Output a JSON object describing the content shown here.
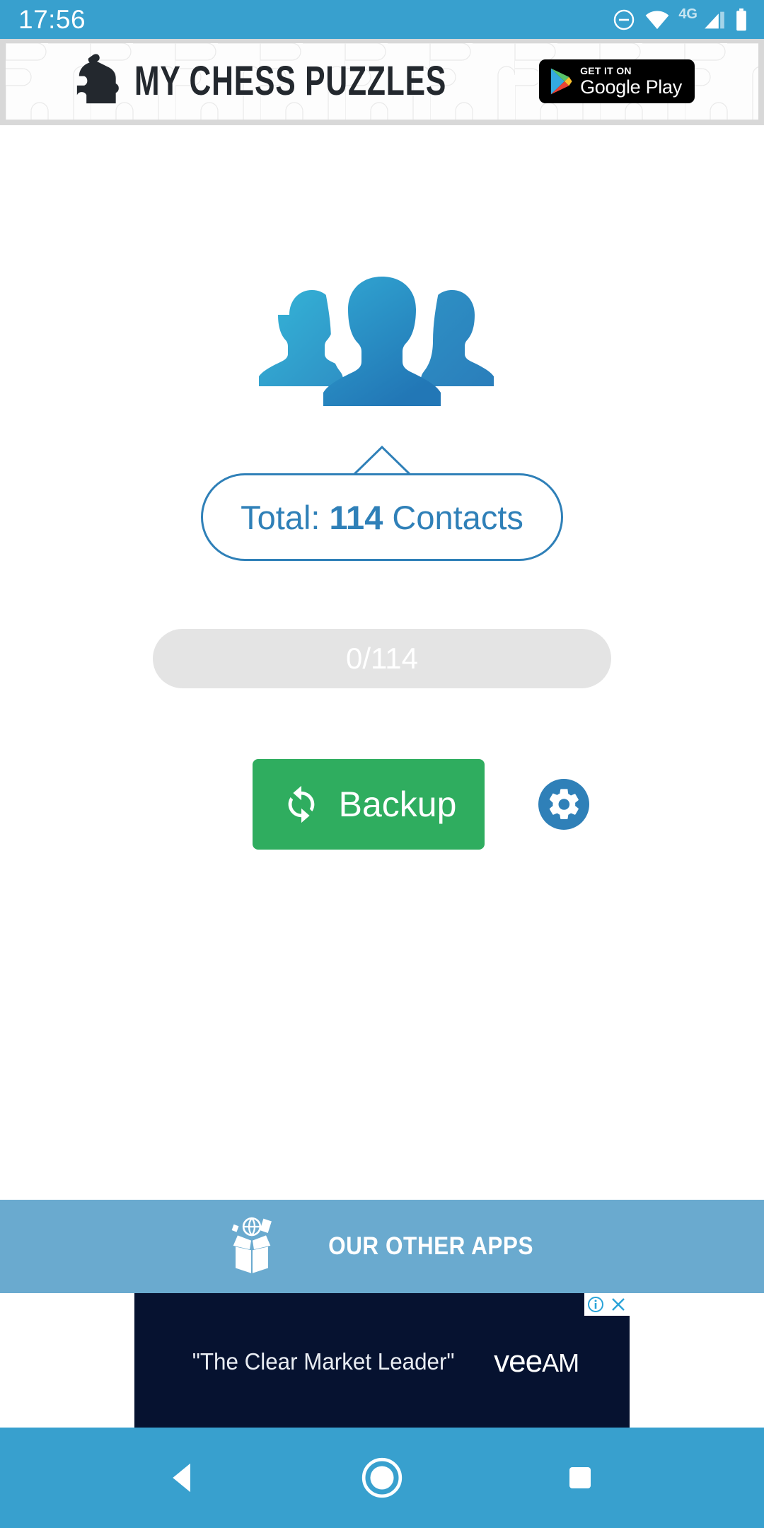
{
  "status_bar": {
    "time": "17:56",
    "background_color": "#38a0ce",
    "icons": [
      {
        "name": "do-not-disturb-icon",
        "label": "Do not disturb"
      },
      {
        "name": "wifi-icon",
        "label": "Wi-Fi"
      },
      {
        "name": "network-type-label",
        "label": "4G"
      },
      {
        "name": "cellular-signal-icon",
        "label": "Signal"
      },
      {
        "name": "battery-icon",
        "label": "Battery"
      }
    ]
  },
  "top_ad": {
    "app_name": "MY CHESS PUZZLES",
    "store_badge": {
      "small_text": "GET IT ON",
      "big_text": "Google Play"
    }
  },
  "main": {
    "contacts_icon_name": "people-group-icon",
    "total_bubble": {
      "prefix": "Total:",
      "count": "114",
      "suffix": "Contacts"
    },
    "progress": {
      "label": "0/114",
      "current": 0,
      "total": 114,
      "percent": 0,
      "track_color": "#e4e4e4"
    },
    "backup_button": {
      "label": "Backup",
      "color": "#2fad5f",
      "icon": "sync-icon"
    },
    "settings_button": {
      "icon": "gear-icon",
      "color": "#2f80b8"
    }
  },
  "other_apps_banner": {
    "label": "OUR OTHER APPS",
    "icon": "open-box-icon",
    "background_color": "#6aaacf"
  },
  "bottom_ad": {
    "headline": "\"The Clear Market Leader\"",
    "brand": "vee",
    "brand_suffix": "AM",
    "background_color": "#061230",
    "info_badge": "i",
    "close_badge": "✕"
  },
  "nav_bar": {
    "background_color": "#38a0ce",
    "buttons": [
      {
        "name": "nav-back-button",
        "label": "Back"
      },
      {
        "name": "nav-home-button",
        "label": "Home"
      },
      {
        "name": "nav-recents-button",
        "label": "Recents"
      }
    ]
  },
  "colors": {
    "accent_blue": "#2f80b8",
    "status_blue": "#38a0ce",
    "banner_blue": "#6aaacf",
    "green": "#2fad5f"
  }
}
